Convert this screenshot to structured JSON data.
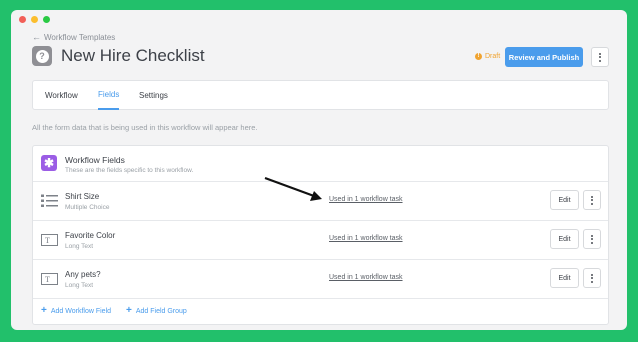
{
  "breadcrumb": {
    "back_label": "Workflow Templates"
  },
  "page": {
    "title": "New Hire Checklist",
    "status": "Draft"
  },
  "actions": {
    "publish_label": "Review and Publish"
  },
  "tabs": [
    {
      "label": "Workflow",
      "active": false
    },
    {
      "label": "Fields",
      "active": true
    },
    {
      "label": "Settings",
      "active": false
    }
  ],
  "info_text": "All the form data that is being used in this workflow will appear here.",
  "fields_card": {
    "title": "Workflow Fields",
    "subtitle": "These are the fields specific to this workflow.",
    "rows": [
      {
        "name": "Shirt Size",
        "type": "Multiple Choice",
        "icon": "list-icon",
        "usage": "Used in 1 workflow task",
        "edit_label": "Edit"
      },
      {
        "name": "Favorite Color",
        "type": "Long Text",
        "icon": "text-field-icon",
        "usage": "Used in 1 workflow task",
        "edit_label": "Edit"
      },
      {
        "name": "Any pets?",
        "type": "Long Text",
        "icon": "text-field-icon",
        "usage": "Used in 1 workflow task",
        "edit_label": "Edit"
      }
    ],
    "add_field_label": "Add Workflow Field",
    "add_group_label": "Add Field Group"
  },
  "colors": {
    "background": "#22c06b",
    "accent": "#4a9cec",
    "draft": "#f0a330",
    "fields_icon": "#9b5de5"
  }
}
